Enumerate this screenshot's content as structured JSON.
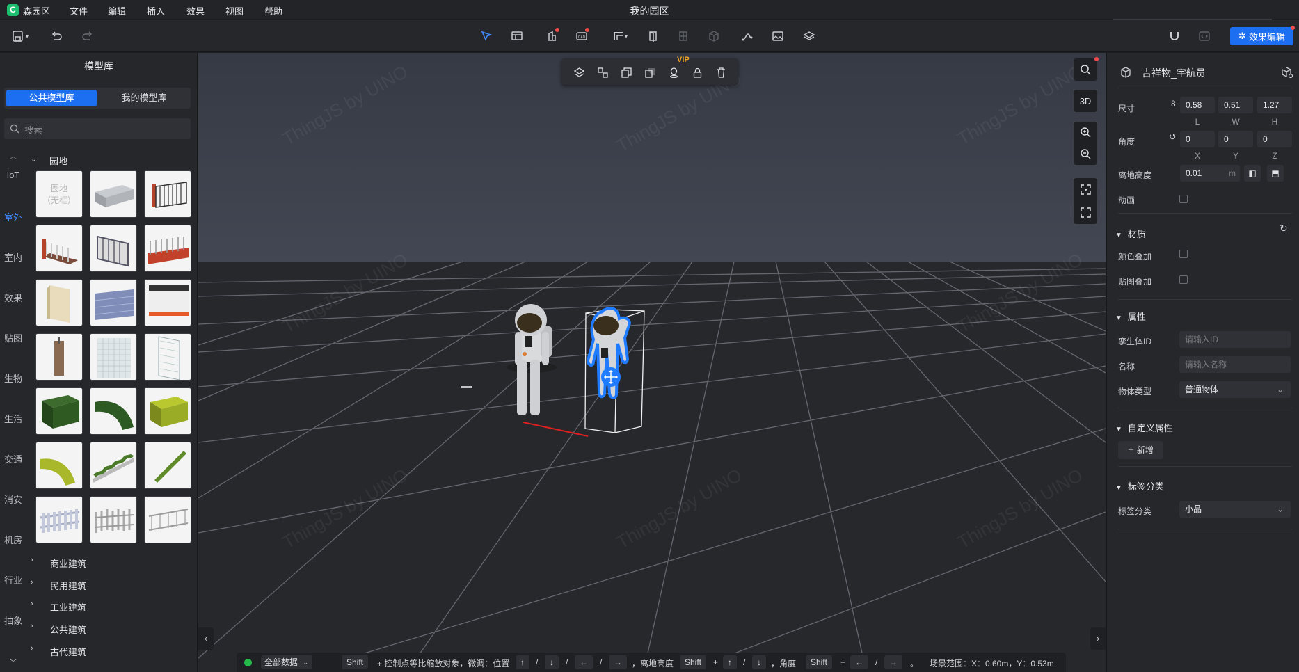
{
  "app": {
    "name": "森园区",
    "logo_letter": "C",
    "doc_title": "我的园区"
  },
  "menu": [
    "文件",
    "编辑",
    "插入",
    "效果",
    "视图",
    "帮助"
  ],
  "toolbar": {
    "effect_edit_label": "效果编辑",
    "cad_label": "CAD"
  },
  "left_panel": {
    "title": "模型库",
    "tabs": [
      "公共模型库",
      "我的模型库"
    ],
    "search_placeholder": "搜索",
    "categories": [
      "IoT",
      "室外",
      "室内",
      "效果",
      "贴图",
      "生物",
      "生活",
      "交通",
      "消安",
      "机房",
      "行业",
      "抽象"
    ],
    "active_category": "室外",
    "open_group": "园地",
    "placeholder_thumb": [
      "圈地",
      "（无框）"
    ],
    "groups": [
      "商业建筑",
      "民用建筑",
      "工业建筑",
      "公共建筑",
      "古代建筑"
    ]
  },
  "object_toolbar": {
    "vip_badge": "VIP"
  },
  "viewport_controls": {
    "view_mode": "3D"
  },
  "watermark": "ThingJS by UINO",
  "status_bar": {
    "data_filter": "全部数据",
    "shift": "Shift",
    "hint_scale": "+ 控制点等比缩放对象，微调：位置",
    "up": "↑",
    "down": "↓",
    "left": "←",
    "right": "→",
    "slash": "/",
    "hint_height": "，离地高度",
    "plus": "+",
    "hint_angle": "，角度",
    "period": "。",
    "scene_range": "场景范围：X：0.60m，Y：0.53m"
  },
  "right_panel": {
    "object_name": "吉祥物_宇航员",
    "size_label": "尺寸",
    "size": [
      "0.58",
      "0.51",
      "1.27"
    ],
    "size_axes": [
      "L",
      "W",
      "H"
    ],
    "angle_label": "角度",
    "angle": [
      "0",
      "0",
      "0"
    ],
    "angle_axes": [
      "X",
      "Y",
      "Z"
    ],
    "height_label": "离地高度",
    "height": "0.01",
    "height_unit": "m",
    "animation_label": "动画",
    "material_section": "材质",
    "color_overlay": "颜色叠加",
    "texture_overlay": "贴图叠加",
    "properties_section": "属性",
    "twin_id_label": "孪生体ID",
    "twin_id_placeholder": "请输入ID",
    "name_label": "名称",
    "name_placeholder": "请输入名称",
    "type_label": "物体类型",
    "type_value": "普通物体",
    "custom_section": "自定义属性",
    "add_label": "新增",
    "tags_section": "标签分类",
    "tag_label": "标签分类",
    "tag_value": "小品"
  }
}
